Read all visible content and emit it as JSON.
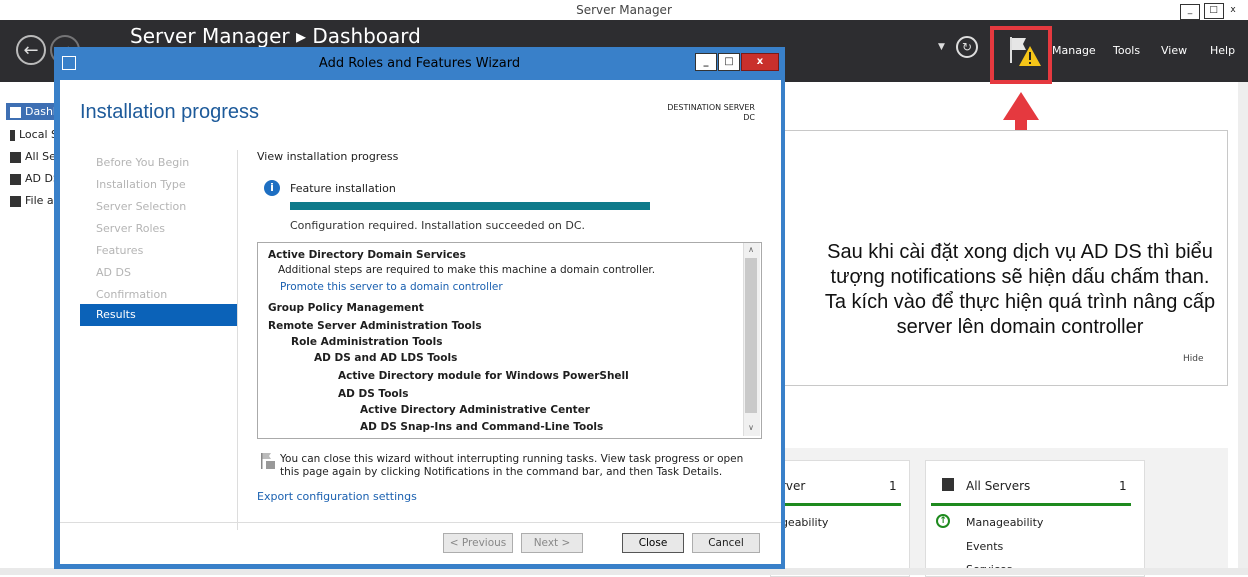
{
  "server_manager": {
    "window_title": "Server Manager",
    "breadcrumb": "Server Manager ▸ Dashboard",
    "menus": [
      "Manage",
      "Tools",
      "View",
      "Help"
    ],
    "sidebar": [
      "Dashboard",
      "Local Server",
      "All Servers",
      "AD DS",
      "File and Storage Services"
    ],
    "tiles": {
      "local": {
        "title": "Local Server",
        "count": "1",
        "row": "Manageability"
      },
      "all": {
        "title": "All Servers",
        "count": "1",
        "rows": [
          "Manageability",
          "Events",
          "Services"
        ]
      }
    },
    "hide_label": "Hide"
  },
  "annotation": {
    "text": "Sau khi cài đặt xong dịch vụ AD DS thì biểu tượng notifications sẽ hiện dấu chấm than. Ta kích vào để thực hiện quá trình nâng cấp server lên domain controller",
    "highlight_color": "#e5393f"
  },
  "wizard": {
    "title": "Add Roles and Features Wizard",
    "heading": "Installation progress",
    "destination_label": "DESTINATION SERVER",
    "destination_server": "DC",
    "steps": [
      "Before You Begin",
      "Installation Type",
      "Server Selection",
      "Server Roles",
      "Features",
      "AD DS",
      "Confirmation",
      "Results"
    ],
    "view_progress_label": "View installation progress",
    "feature_installation": "Feature installation",
    "progress": 1.0,
    "status_text": "Configuration required. Installation succeeded on DC.",
    "results": [
      {
        "text": "Active Directory Domain Services",
        "bold": true,
        "indent": 0
      },
      {
        "text": "Additional steps are required to make this machine a domain controller.",
        "bold": false,
        "indent": 1
      },
      {
        "text": "Promote this server to a domain controller",
        "bold": false,
        "indent": 1,
        "link": true
      },
      {
        "text": "Group Policy Management",
        "bold": true,
        "indent": 0
      },
      {
        "text": "Remote Server Administration Tools",
        "bold": true,
        "indent": 0
      },
      {
        "text": "Role Administration Tools",
        "bold": true,
        "indent": 1
      },
      {
        "text": "AD DS and AD LDS Tools",
        "bold": true,
        "indent": 2
      },
      {
        "text": "Active Directory module for Windows PowerShell",
        "bold": true,
        "indent": 3
      },
      {
        "text": "AD DS Tools",
        "bold": true,
        "indent": 3
      },
      {
        "text": "Active Directory Administrative Center",
        "bold": true,
        "indent": 4
      },
      {
        "text": "AD DS Snap-Ins and Command-Line Tools",
        "bold": true,
        "indent": 4
      }
    ],
    "close_note": "You can close this wizard without interrupting running tasks. View task progress or open this page again by clicking Notifications in the command bar, and then Task Details.",
    "export_link": "Export configuration settings",
    "buttons": {
      "previous": "< Previous",
      "next": "Next >",
      "close": "Close",
      "cancel": "Cancel"
    }
  },
  "colors": {
    "accent": "#0b62b8",
    "progress": "#0e7a8a",
    "warning": "#f5c518"
  }
}
